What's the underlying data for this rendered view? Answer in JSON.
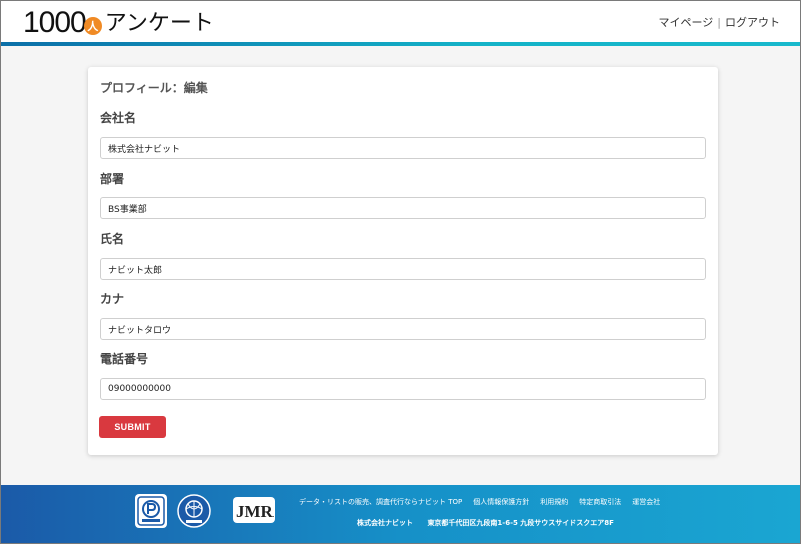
{
  "header": {
    "logo_number": "1000",
    "logo_badge": "人",
    "logo_text": "アンケート",
    "nav": {
      "mypage": "マイページ",
      "separator": "|",
      "logout": "ログアウト"
    }
  },
  "form": {
    "title": "プロフィール：編集",
    "fields": [
      {
        "label": "会社名",
        "value": "株式会社ナビット"
      },
      {
        "label": "部署",
        "value": "BS事業部"
      },
      {
        "label": "氏名",
        "value": "ナビット太郎"
      },
      {
        "label": "カナ",
        "value": "ナビットタロウ"
      },
      {
        "label": "電話番号",
        "value": "09000000000"
      }
    ],
    "submit_label": "SUBMIT"
  },
  "footer": {
    "links": [
      "データ・リストの販売、調査代行ならナビット TOP",
      "個人情報保護方針",
      "利用規約",
      "特定商取引法",
      "運営会社"
    ],
    "company": "株式会社ナビット",
    "address": "東京都千代田区九段南1-6-5 九段サウスサイドスクエア8F",
    "seal_jmra_text": "JMRA"
  },
  "colors": {
    "accent": "#14b3c8",
    "submit": "#d9393f",
    "logo_badge": "#f08a24",
    "footer": "#1690c8"
  }
}
